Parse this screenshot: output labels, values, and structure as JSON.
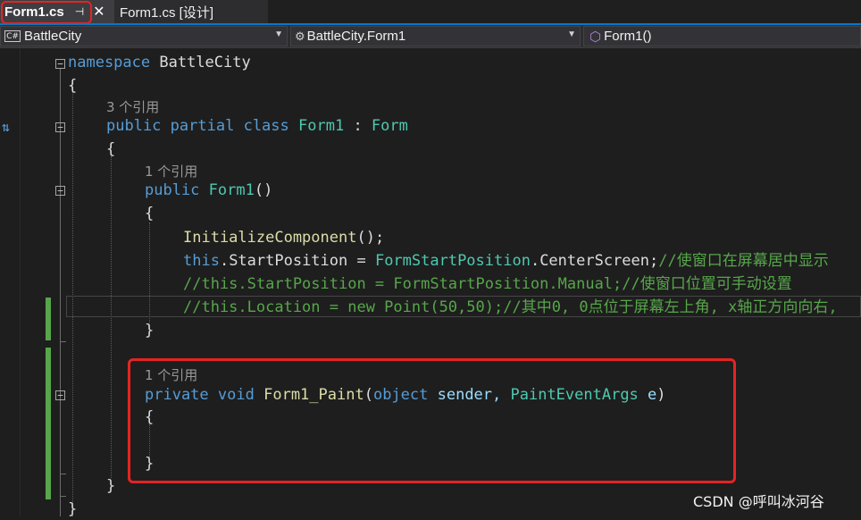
{
  "tabs": {
    "active": {
      "label": "Form1.cs",
      "pin": "⊣",
      "close": "✕"
    },
    "inactive": {
      "label": "Form1.cs [设计]"
    }
  },
  "navbar": {
    "project": "BattleCity",
    "project_badge": "C#",
    "type": "BattleCity.Form1",
    "member": "Form1()"
  },
  "code": {
    "namespace_kw": "namespace",
    "namespace_name": "BattleCity",
    "brace_open": "{",
    "brace_close": "}",
    "class_refs": "3 个引用",
    "class_public": "public",
    "class_partial": "partial",
    "class_kw": "class",
    "class_name": "Form1",
    "class_colon": " : ",
    "class_base": "Form",
    "ctor_refs": "1 个引用",
    "ctor_public": "public",
    "ctor_name": "Form1",
    "ctor_parens": "()",
    "init_call": "InitializeComponent",
    "init_tail": "();",
    "this_kw": "this",
    "sp_prop": ".StartPosition = ",
    "sp_type": "FormStartPosition",
    "sp_value": ".CenterScreen;",
    "sp_comment": "//使窗口在屏幕居中显示",
    "comment_manual": "//this.StartPosition = FormStartPosition.Manual;//使窗口位置可手动设置",
    "comment_location": "//this.Location = new Point(50,50);//其中0, 0点位于屏幕左上角, x轴正方向向右,",
    "paint_refs": "1 个引用",
    "paint_private": "private",
    "paint_void": "void",
    "paint_name": "Form1_Paint",
    "paint_paren_open": "(",
    "paint_object": "object",
    "paint_sender": " sender, ",
    "paint_args_type": "PaintEventArgs",
    "paint_e": " e",
    "paint_paren_close": ")"
  },
  "watermark": "CSDN @呼叫冰河谷",
  "icons": [
    "pin-icon",
    "close-icon",
    "csharp-project-icon",
    "class-icon",
    "method-cube-icon",
    "dropdown-arrow-icon",
    "implementation-icon",
    "collapse-icon"
  ],
  "colors": {
    "keyword": "#569cd6",
    "type": "#4ec9b0",
    "method": "#dcdcaa",
    "identifier": "#9cdcfe",
    "comment": "#57a64a",
    "highlight_box": "#e62323",
    "change_bar": "#57a64a"
  }
}
